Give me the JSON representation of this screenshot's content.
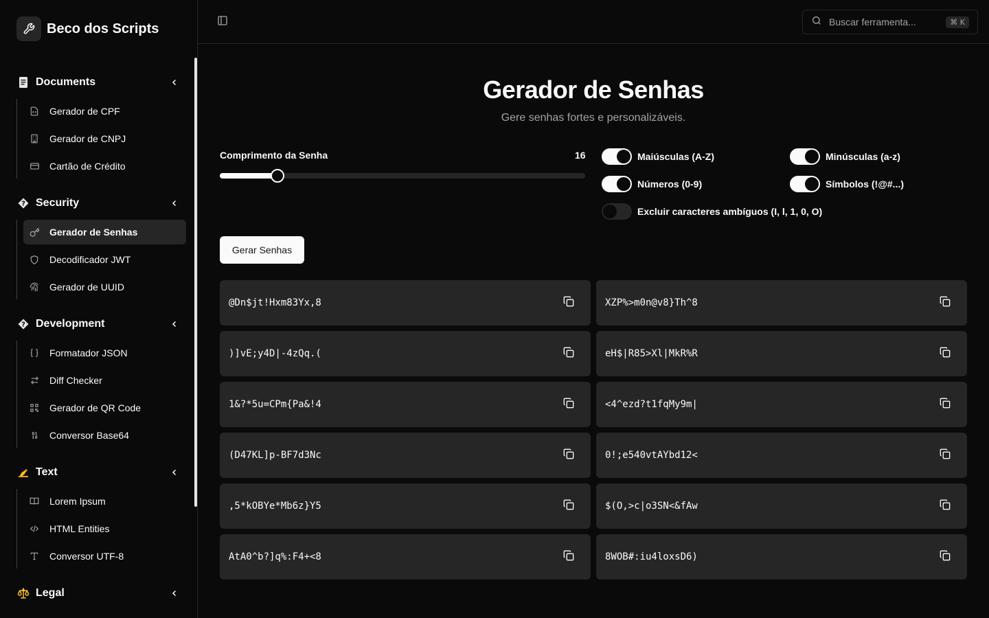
{
  "brand": {
    "name": "Beco dos Scripts",
    "logo_icon": "wrench-icon"
  },
  "sidebar": {
    "groups": [
      {
        "label": "Documents",
        "icon": "document-icon",
        "items": [
          {
            "label": "Gerador de CPF",
            "icon": "file-code-icon"
          },
          {
            "label": "Gerador de CNPJ",
            "icon": "building-icon"
          },
          {
            "label": "Cartão de Crédito",
            "icon": "credit-card-icon"
          }
        ]
      },
      {
        "label": "Security",
        "icon": "diamond-icon",
        "items": [
          {
            "label": "Gerador de Senhas",
            "icon": "key-icon",
            "active": true
          },
          {
            "label": "Decodificador JWT",
            "icon": "shield-icon"
          },
          {
            "label": "Gerador de UUID",
            "icon": "fingerprint-icon"
          }
        ]
      },
      {
        "label": "Development",
        "icon": "diamond-icon",
        "items": [
          {
            "label": "Formatador JSON",
            "icon": "braces-icon"
          },
          {
            "label": "Diff Checker",
            "icon": "arrows-swap-icon"
          },
          {
            "label": "Gerador de QR Code",
            "icon": "qr-code-icon"
          },
          {
            "label": "Conversor Base64",
            "icon": "binary-icon"
          }
        ]
      },
      {
        "label": "Text",
        "icon": "writing-hand-icon",
        "items": [
          {
            "label": "Lorem Ipsum",
            "icon": "book-open-icon"
          },
          {
            "label": "HTML Entities",
            "icon": "code-icon"
          },
          {
            "label": "Conversor UTF-8",
            "icon": "type-icon"
          }
        ]
      },
      {
        "label": "Legal",
        "icon": "scales-icon",
        "items": []
      }
    ]
  },
  "topbar": {
    "search_placeholder": "Buscar ferramenta...",
    "search_shortcut": "⌘ K"
  },
  "main": {
    "title": "Gerador de Senhas",
    "subtitle": "Gere senhas fortes e personalizáveis.",
    "length_label": "Comprimento da Senha",
    "length_value": "16",
    "length_fraction": 0.157,
    "options": [
      {
        "label": "Maiúsculas (A-Z)",
        "on": true
      },
      {
        "label": "Minúsculas (a-z)",
        "on": true
      },
      {
        "label": "Números (0-9)",
        "on": true
      },
      {
        "label": "Símbolos (!@#...)",
        "on": true
      },
      {
        "label": "Excluir caracteres ambíguos (I, l, 1, 0, O)",
        "on": false
      }
    ],
    "generate_label": "Gerar Senhas",
    "passwords": [
      "@Dn$jt!Hxm83Yx,8",
      "XZP%>m0n@v8}Th^8",
      ")]vE;y4D|-4zQq.(",
      "eH$|R85>Xl|MkR%R",
      "1&?*5u=CPm{Pa&!4",
      "<4^ezd?t1fqMy9m|",
      "(D47KL]p-BF7d3Nc",
      "0!;e540vtAYbd12<",
      ",5*kOBYe*Mb6z}Y5",
      "$(O,>c|o3SN<&fAw",
      "AtA0^b?]q%:F4+<8",
      "8WOB#:iu4loxsD6)"
    ]
  }
}
